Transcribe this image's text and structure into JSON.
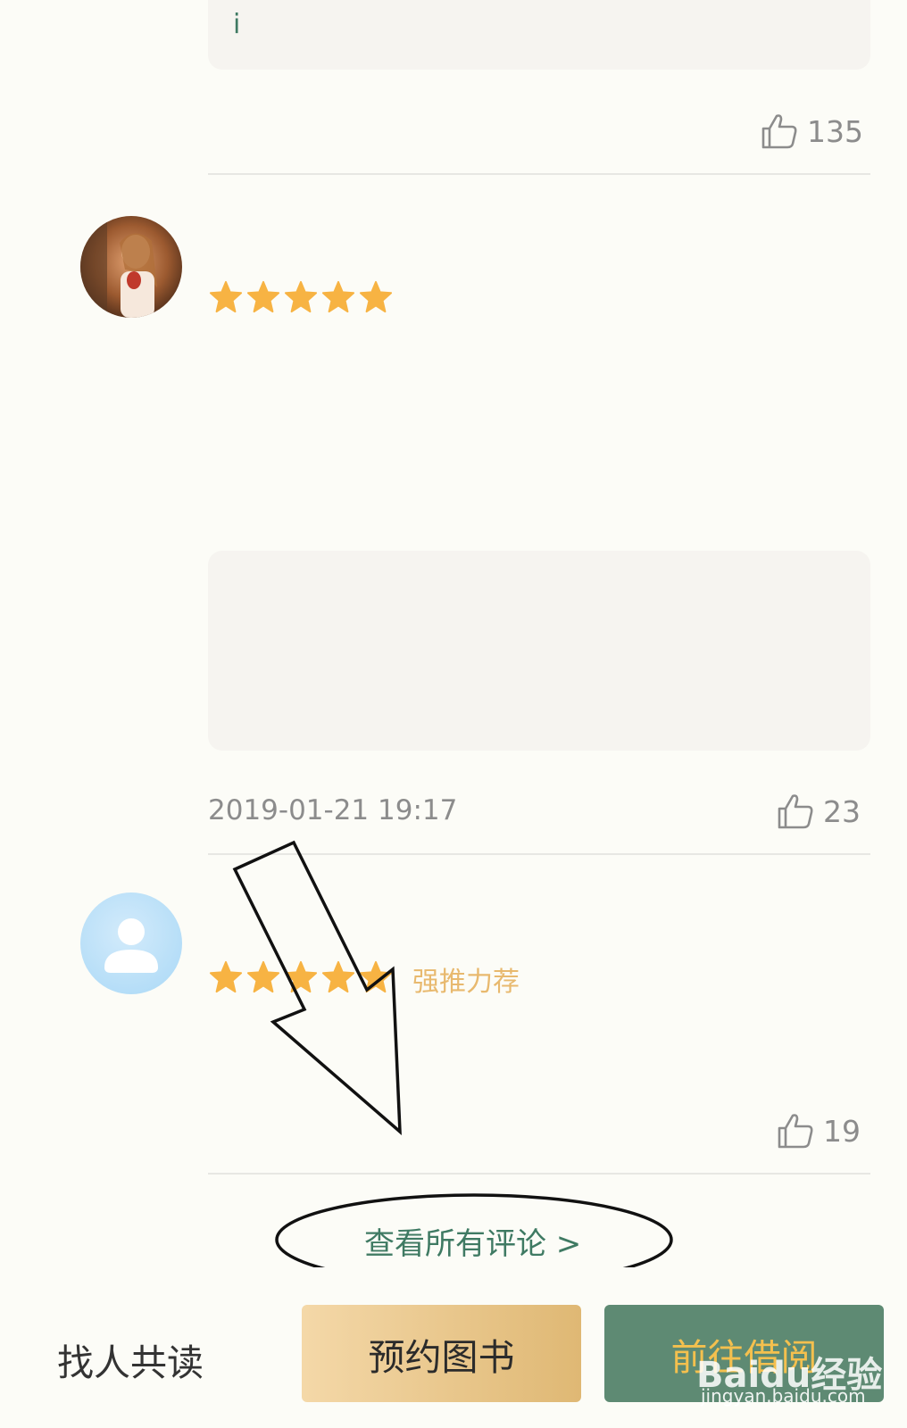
{
  "reviews": [
    {
      "snippet": "i",
      "likes": "135"
    },
    {
      "date": "2019-01-21 19:17",
      "likes": "23",
      "rating": 5
    },
    {
      "tag": "强推力荐",
      "likes": "19",
      "rating": 5
    }
  ],
  "view_all": "查看所有评论 >",
  "bottom_bar": {
    "find_reader": "找人共读",
    "reserve": "预约图书",
    "borrow": "前往借阅"
  },
  "watermark": {
    "brand": "Baidu经验",
    "url": "jingyan.baidu.com"
  },
  "colors": {
    "background": "#fcfcf7",
    "star": "#f7b343",
    "brand_green": "#5e8a73",
    "gold": "#dfb874",
    "tag": "#e8b96e"
  },
  "icons": [
    "thumbs-up-icon",
    "star-icon",
    "user-icon",
    "arrow-annotation",
    "ellipse-annotation"
  ]
}
